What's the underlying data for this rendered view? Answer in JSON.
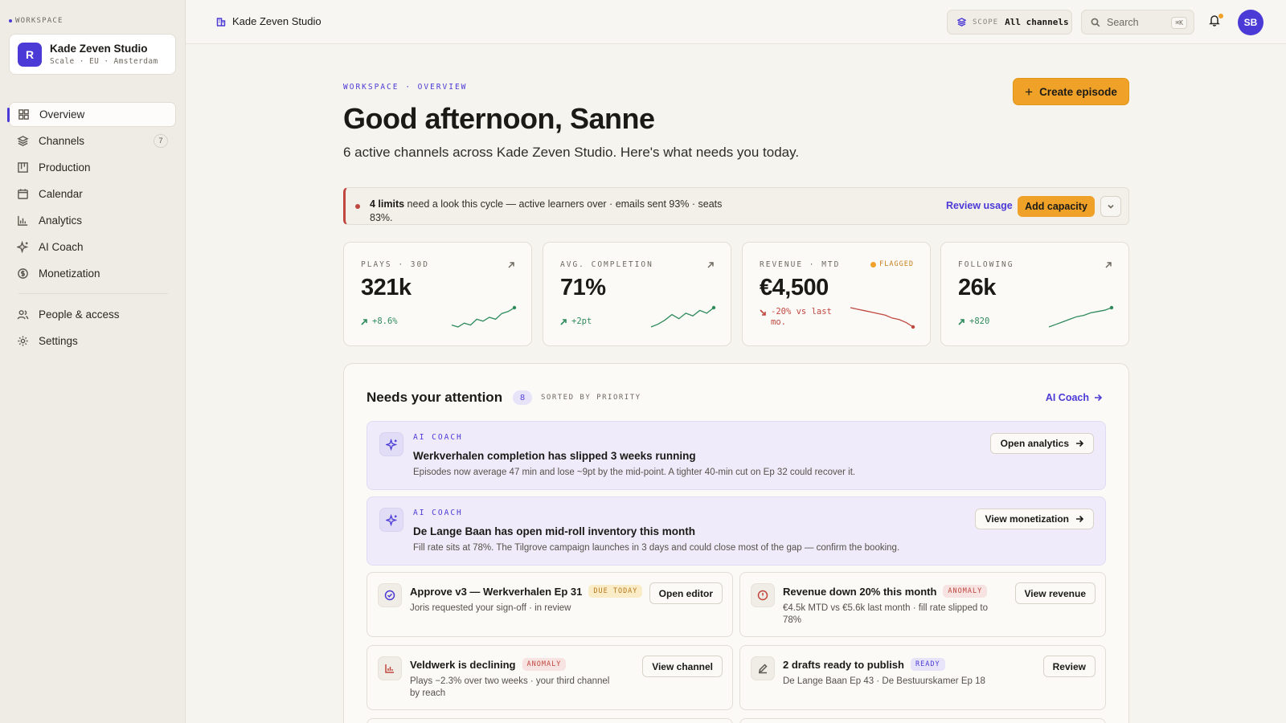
{
  "sidebar": {
    "workspace_label": "WORKSPACE",
    "workspace": {
      "initial": "R",
      "name": "Kade Zeven Studio",
      "meta": "Scale · EU · Amsterdam"
    },
    "items": [
      {
        "label": "Overview",
        "icon": "grid-icon"
      },
      {
        "label": "Channels",
        "icon": "layers-icon",
        "count": "7"
      },
      {
        "label": "Production",
        "icon": "kanban-icon"
      },
      {
        "label": "Calendar",
        "icon": "calendar-icon"
      },
      {
        "label": "Analytics",
        "icon": "bar-chart-icon"
      },
      {
        "label": "AI Coach",
        "icon": "sparkle-icon"
      },
      {
        "label": "Monetization",
        "icon": "coin-icon"
      }
    ],
    "secondary": [
      {
        "label": "People & access",
        "icon": "people-icon"
      },
      {
        "label": "Settings",
        "icon": "gear-icon"
      }
    ]
  },
  "topbar": {
    "crumb": "Kade Zeven Studio",
    "scope_key": "SCOPE",
    "scope_value": "All channels",
    "search_placeholder": "Search",
    "search_kbd": "⌘K",
    "user_initials": "SB"
  },
  "header": {
    "eyebrow": "WORKSPACE · OVERVIEW",
    "title": "Good afternoon, Sanne",
    "subtitle": "6 active channels across Kade Zeven Studio. Here's what needs you today.",
    "create_label": "Create episode"
  },
  "alert": {
    "bold": "4 limits",
    "text": " need a look this cycle — active learners over · emails sent 93% · seats 83%.",
    "review_label": "Review usage",
    "add_label": "Add capacity"
  },
  "kpis": [
    {
      "label": "PLAYS · 30D",
      "value": "321k",
      "delta": "+8.6%",
      "trend": "up",
      "spark": [
        3,
        2,
        4,
        3,
        6,
        5,
        7,
        6,
        9,
        10,
        12
      ],
      "color": "#2f8a5c"
    },
    {
      "label": "AVG. COMPLETION",
      "value": "71%",
      "delta": "+2pt",
      "trend": "up",
      "spark": [
        2,
        4,
        7,
        11,
        8,
        12,
        10,
        14,
        12,
        16
      ],
      "color": "#2f8a5c"
    },
    {
      "label": "REVENUE · MTD",
      "value": "€4,500",
      "delta": "-20% vs last mo.",
      "trend": "down",
      "flag": "FLAGGED",
      "spark": [
        16,
        15,
        14,
        13,
        12,
        11,
        9,
        8,
        6,
        3
      ],
      "color": "#c0473f"
    },
    {
      "label": "FOLLOWING",
      "value": "26k",
      "delta": "+820",
      "trend": "up",
      "spark": [
        1,
        3,
        5,
        7,
        9,
        10,
        12,
        13,
        14,
        16
      ],
      "color": "#2f8a5c"
    }
  ],
  "attention": {
    "title": "Needs your attention",
    "count": "8",
    "sort": "SORTED BY PRIORITY",
    "link": "AI Coach",
    "coach": [
      {
        "tag": "AI COACH",
        "title": "Werkverhalen completion has slipped 3 weeks running",
        "body": "Episodes now average 47 min and lose ~9pt by the mid-point. A tighter 40-min cut on Ep 32 could recover it.",
        "action": "Open analytics"
      },
      {
        "tag": "AI COACH",
        "title": "De Lange Baan has open mid-roll inventory this month",
        "body": "Fill rate sits at 78%. The Tilgrove campaign launches in 3 days and could close most of the gap — confirm the booking.",
        "action": "View monetization"
      }
    ],
    "tasks": [
      {
        "title": "Approve v3 — Werkverhalen Ep 31",
        "badge": "DUE TODAY",
        "badge_type": "due",
        "body": "Joris requested your sign-off · in review",
        "action": "Open editor",
        "icon": "check-circle-icon"
      },
      {
        "title": "Revenue down 20% this month",
        "badge": "ANOMALY",
        "badge_type": "anom",
        "body": "€4.5k MTD vs €5.6k last month · fill rate slipped to 78%",
        "action": "View revenue",
        "icon": "alert-circle-icon"
      },
      {
        "title": "Veldwerk is declining",
        "badge": "ANOMALY",
        "badge_type": "anom",
        "body": "Plays −2.3% over two weeks · your third channel by reach",
        "action": "View channel",
        "icon": "bar-chart-icon"
      },
      {
        "title": "2 drafts ready to publish",
        "badge": "READY",
        "badge_type": "ready",
        "body": "De Lange Baan Ep 43 · De Bestuurskamer Ep 18",
        "action": "Review",
        "icon": "pen-icon"
      }
    ]
  }
}
